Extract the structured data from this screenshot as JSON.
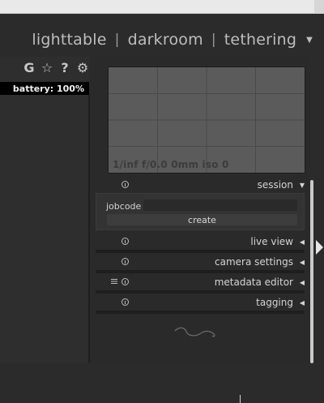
{
  "header": {
    "views": [
      "lighttable",
      "darkroom",
      "tethering"
    ],
    "separator": "|",
    "dropdown_icon": "triangle-down-icon"
  },
  "left_panel": {
    "icons": [
      "grouping-icon",
      "star-icon",
      "help-icon",
      "gear-icon"
    ],
    "icon_glyphs": [
      "G",
      "☆",
      "?",
      "⚙"
    ],
    "battery": "battery: 100%"
  },
  "preview": {
    "info": "1/inf f/0.0 0mm iso 0"
  },
  "modules": {
    "session": {
      "label": "session",
      "arrow": "▼"
    },
    "live_view": {
      "label": "live view",
      "arrow": "◀"
    },
    "camera_settings": {
      "label": "camera settings",
      "arrow": "◀"
    },
    "metadata_editor": {
      "label": "metadata editor",
      "arrow": "◀"
    },
    "tagging": {
      "label": "tagging",
      "arrow": "◀"
    }
  },
  "session": {
    "jobcode_label": "jobcode",
    "jobcode_value": "",
    "create_label": "create"
  },
  "colors": {
    "background": "#2b2b2b",
    "preview": "#5b5b5b",
    "battery_bg": "#000000",
    "text": "#d4d4d4"
  }
}
